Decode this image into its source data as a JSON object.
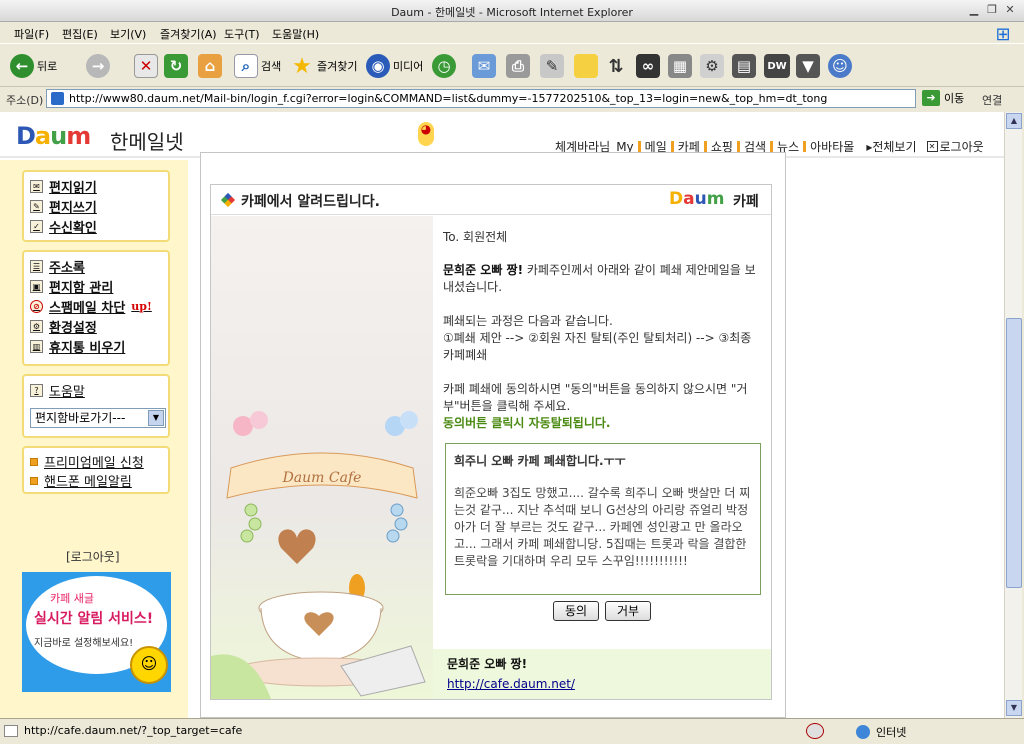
{
  "window": {
    "title": "Daum - 한메일넷 - Microsoft Internet Explorer"
  },
  "menu": {
    "items": [
      "파일(F)",
      "편집(E)",
      "보기(V)",
      "즐겨찾기(A)",
      "도구(T)",
      "도움말(H)"
    ]
  },
  "toolbar": {
    "back": "뒤로",
    "search": "검색",
    "favorites": "즐겨찾기",
    "media": "미디어"
  },
  "address": {
    "label": "주소(D)",
    "url": "http://www80.daum.net/Mail-bin/login_f.cgi?error=login&COMMAND=list&dummy=-1577202510&_top_13=login=new&_top_hm=dt_tong",
    "go": "이동",
    "links": "연결"
  },
  "header": {
    "service_name": "한메일넷",
    "nav": [
      "체계바라님",
      "My",
      "메일",
      "카페",
      "쇼핑",
      "검색",
      "뉴스",
      "아바타몰"
    ],
    "view_all": "▸전체보기",
    "logout": "로그아웃"
  },
  "sidebar": {
    "box1": [
      "편지읽기",
      "편지쓰기",
      "수신확인"
    ],
    "box2": [
      "주소록",
      "편지함 관리",
      "스팸메일 차단",
      "환경설정",
      "휴지통 비우기"
    ],
    "up_badge": "up!",
    "help": "도움말",
    "folder_select": "편지함바로가기---",
    "box4": [
      "프리미엄메일 신청",
      "핸드폰 메일알림"
    ],
    "logout": "[로그아웃]",
    "banner": {
      "line1": "카페 새글",
      "line2": "실시간 알림 서비스!",
      "line3": "지금바로 설정해보세요!"
    }
  },
  "card": {
    "title": "카페에서 알려드립니다.",
    "brand": "카페",
    "illustration_label": "Daum Cafe",
    "to": "To. 회원전체",
    "intro_bold": "문희준 오빠 짱!",
    "intro_rest": " 카페주인께서 아래와 같이 폐쇄 제안메일을 보내셨습니다.",
    "process_intro": "폐쇄되는 과정은 다음과 같습니다.",
    "process_steps": "①폐쇄 제안 --> ②회원 자진 탈퇴(주인 탈퇴처리) --> ③최종 카페폐쇄",
    "consent_text": "카페 폐쇄에 동의하시면 \"동의\"버튼을 동의하지 않으시면 \"거부\"버튼을 클릭해 주세요.",
    "auto_leave": "동의버튼 클릭시 자동탈퇴됩니다.",
    "message_title": "희주니 오빠 카페 폐쇄합니다.ㅜㅜ",
    "message_body": "희준오빠 3집도 망했고.... 갈수록 희주니 오빠 뱃살만 더 찌는것 같구... 지난 추석때 보니 G선상의 아리랑 쥬얼리 박정아가 더 잘 부르는 것도 같구... 카페엔 성인광고 만 올라오고... 그래서 카페 폐쇄합니당. 5집때는 트롯과 락을 결합한 트롯락을 기대하며 우리 모두 스꾸임!!!!!!!!!!!",
    "agree": "동의",
    "reject": "거부",
    "footer_title": "문희준 오빠 짱!",
    "footer_link": "http://cafe.daum.net/"
  },
  "status": {
    "text": "http://cafe.daum.net/?_top_target=cafe",
    "zone": "인터넷"
  }
}
